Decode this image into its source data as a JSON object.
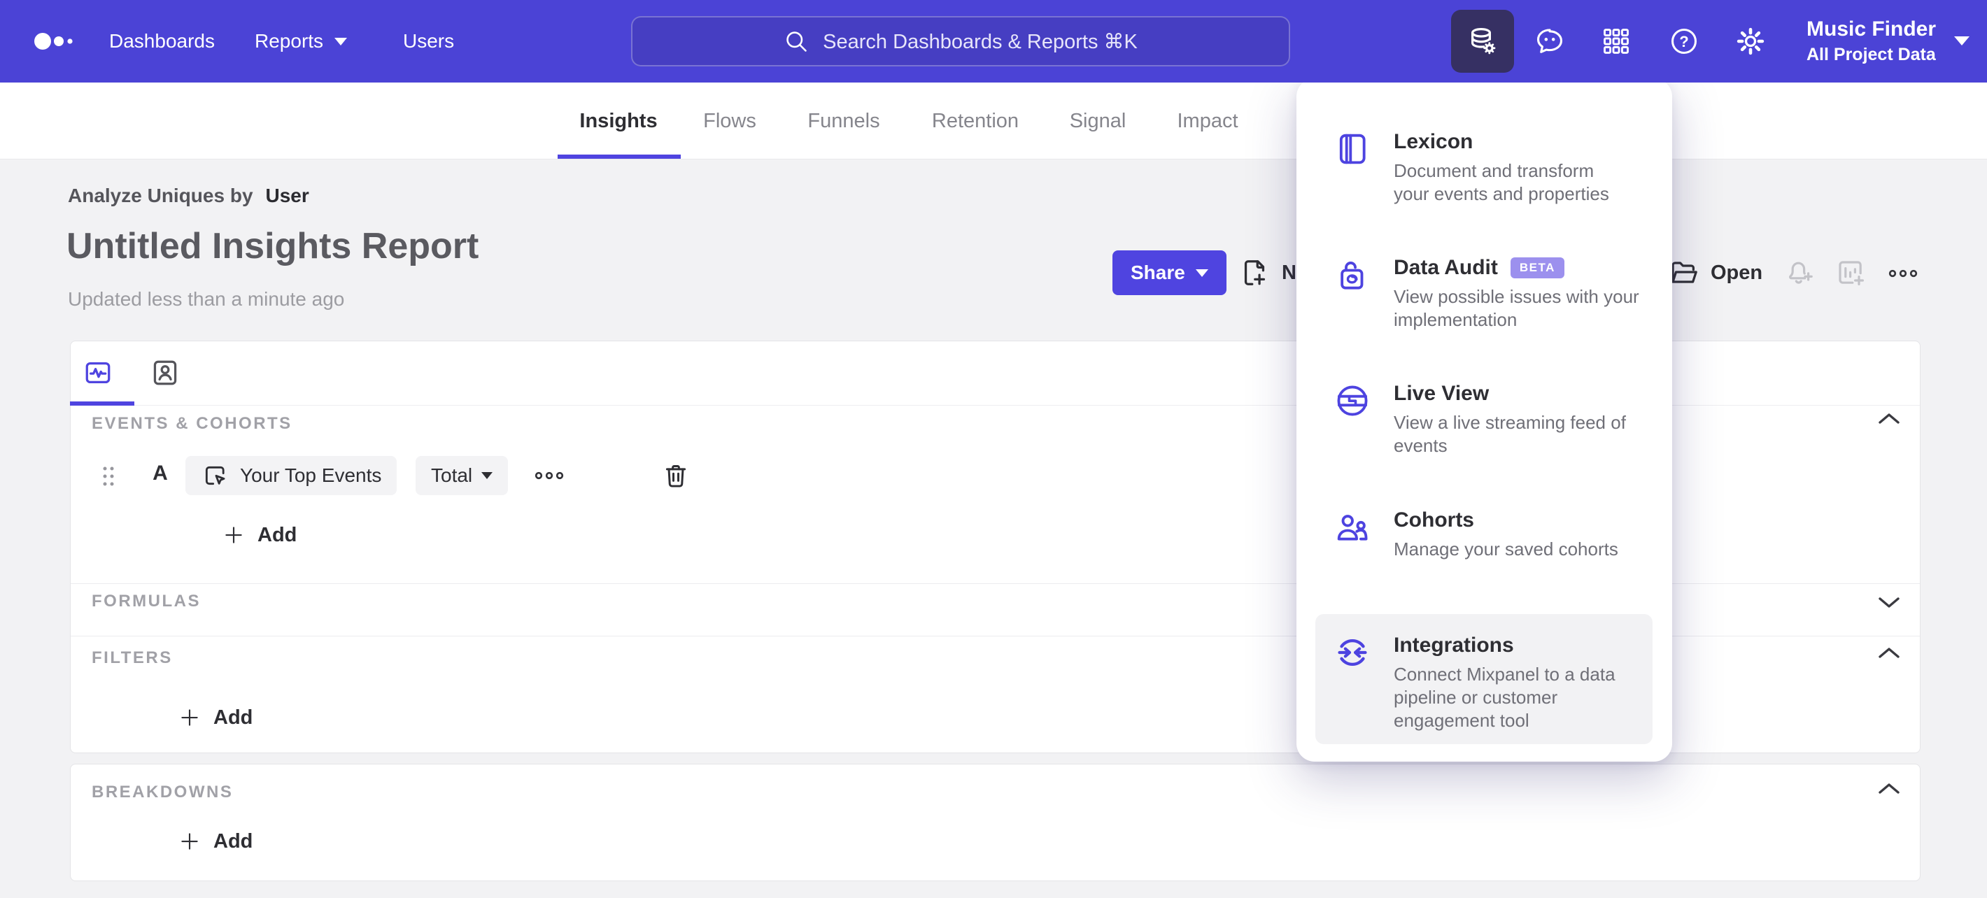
{
  "colors": {
    "accent": "#4f44e0",
    "topbar": "#4b43d6",
    "topbar_active_button": "#363063",
    "beta_badge": "#9c90ee",
    "page_background": "#f2f2f4"
  },
  "topbar": {
    "nav": [
      {
        "label": "Dashboards"
      },
      {
        "label": "Reports"
      },
      {
        "label": "Users"
      }
    ],
    "search": {
      "placeholder": "Search Dashboards & Reports ⌘K"
    },
    "project": {
      "name": "Music Finder",
      "scope": "All Project Data"
    }
  },
  "tabs": {
    "items": [
      {
        "label": "Insights",
        "active": true
      },
      {
        "label": "Flows",
        "active": false
      },
      {
        "label": "Funnels",
        "active": false
      },
      {
        "label": "Retention",
        "active": false
      },
      {
        "label": "Signal",
        "active": false
      },
      {
        "label": "Impact",
        "active": false
      }
    ]
  },
  "report": {
    "analyze_prefix": "Analyze Uniques by",
    "analyze_value": "User",
    "title": "Untitled Insights Report",
    "updated": "Updated less than a minute ago"
  },
  "toolbar": {
    "share_label": "Share",
    "new_label": "New",
    "open_label": "Open"
  },
  "builder": {
    "events_label": "EVENTS & COHORTS",
    "series_letter": "A",
    "event_name": "Your Top Events",
    "aggregation": "Total",
    "add_label": "Add",
    "formulas_label": "FORMULAS",
    "filters_label": "FILTERS",
    "breakdowns_label": "BREAKDOWNS"
  },
  "data_menu": {
    "items": [
      {
        "title": "Lexicon",
        "desc": "Document and transform\nyour events and properties"
      },
      {
        "title": "Data Audit",
        "badge": "BETA",
        "desc": "View possible issues with your\nimplementation"
      },
      {
        "title": "Live View",
        "desc": "View a live streaming feed of\nevents"
      },
      {
        "title": "Cohorts",
        "desc": "Manage your saved cohorts"
      },
      {
        "title": "Integrations",
        "desc": "Connect Mixpanel to a data\npipeline or customer\nengagement tool",
        "highlighted": true
      }
    ]
  }
}
